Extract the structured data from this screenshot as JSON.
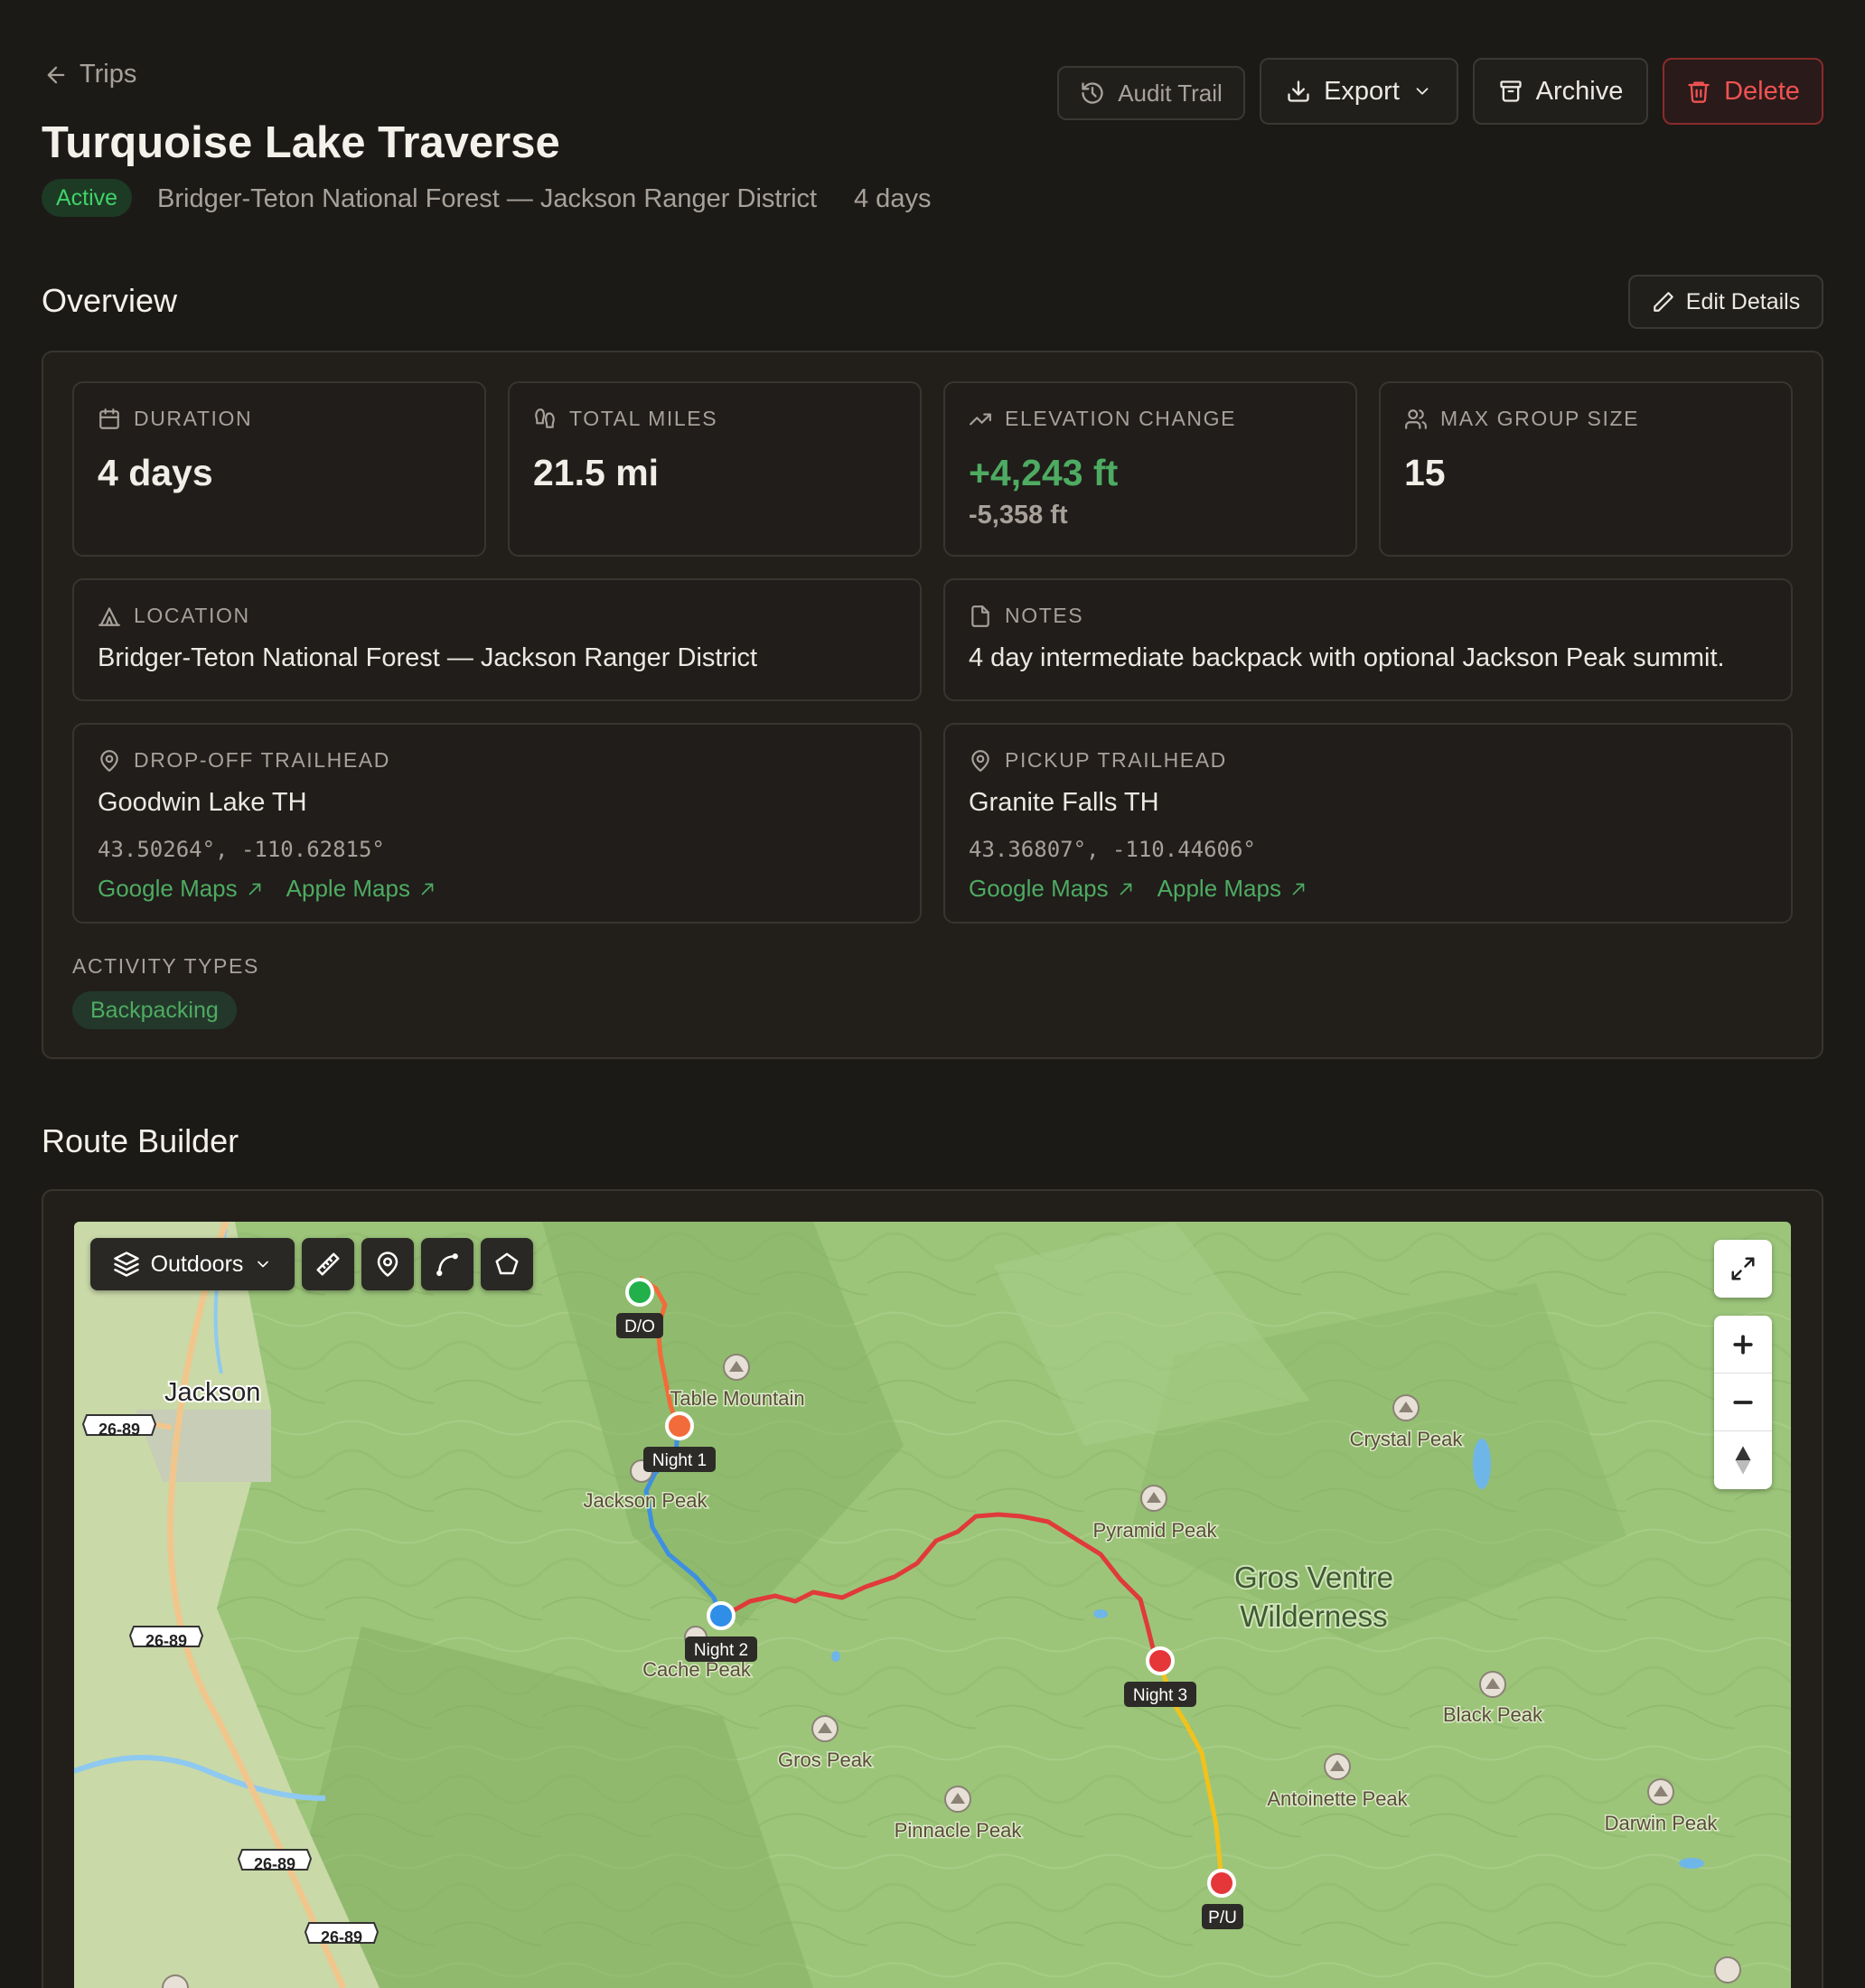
{
  "breadcrumb": {
    "label": "Trips"
  },
  "header": {
    "title": "Turquoise Lake Traverse",
    "status": "Active",
    "subtitle_location": "Bridger-Teton National Forest — Jackson Ranger District",
    "subtitle_duration": "4 days",
    "actions": {
      "audit": "Audit Trail",
      "export": "Export",
      "archive": "Archive",
      "delete": "Delete"
    }
  },
  "overview": {
    "title": "Overview",
    "edit_label": "Edit Details",
    "stats": {
      "duration": {
        "label": "Duration",
        "value": "4 days"
      },
      "miles": {
        "label": "Total Miles",
        "value": "21.5 mi"
      },
      "elevation": {
        "label": "Elevation Change",
        "gain": "+4,243 ft",
        "loss": "-5,358 ft"
      },
      "group": {
        "label": "Max Group Size",
        "value": "15"
      }
    },
    "location": {
      "label": "Location",
      "value": "Bridger-Teton National Forest — Jackson Ranger District"
    },
    "notes": {
      "label": "Notes",
      "value": "4 day intermediate backpack with optional Jackson Peak summit."
    },
    "dropoff": {
      "label": "Drop-off Trailhead",
      "name": "Goodwin Lake TH",
      "coords": "43.50264°, -110.62815°",
      "google": "Google Maps",
      "apple": "Apple Maps"
    },
    "pickup": {
      "label": "Pickup Trailhead",
      "name": "Granite Falls TH",
      "coords": "43.36807°, -110.44606°",
      "google": "Google Maps",
      "apple": "Apple Maps"
    },
    "activity": {
      "label": "Activity Types",
      "tags": [
        "Backpacking"
      ]
    }
  },
  "route_builder": {
    "title": "Route Builder",
    "basemap": "Outdoors",
    "map": {
      "town": "Jackson",
      "wilderness_line1": "Gros Ventre",
      "wilderness_line2": "Wilderness",
      "highway": "26-89",
      "peaks": {
        "table": "Table Mountain",
        "jackson": "Jackson Peak",
        "cache": "Cache Peak",
        "gros": "Gros Peak",
        "pinnacle": "Pinnacle Peak",
        "pyramid": "Pyramid Peak",
        "crystal": "Crystal Peak",
        "black": "Black Peak",
        "antoinette": "Antoinette Peak",
        "darwin": "Darwin Peak"
      },
      "markers": {
        "dropoff": "D/O",
        "night1": "Night 1",
        "night2": "Night 2",
        "night3": "Night 3",
        "pickup": "P/U"
      },
      "colors": {
        "segment1": "#f26b3a",
        "segment2": "#3f8fe0",
        "segment3": "#e03a3a",
        "segment4": "#f2c21b",
        "dropoff_marker": "#22b04b",
        "night1_marker": "#f26b3a",
        "night2_marker": "#2f8ee8",
        "night3_marker": "#e5373a",
        "pickup_marker": "#e5373a"
      }
    }
  }
}
